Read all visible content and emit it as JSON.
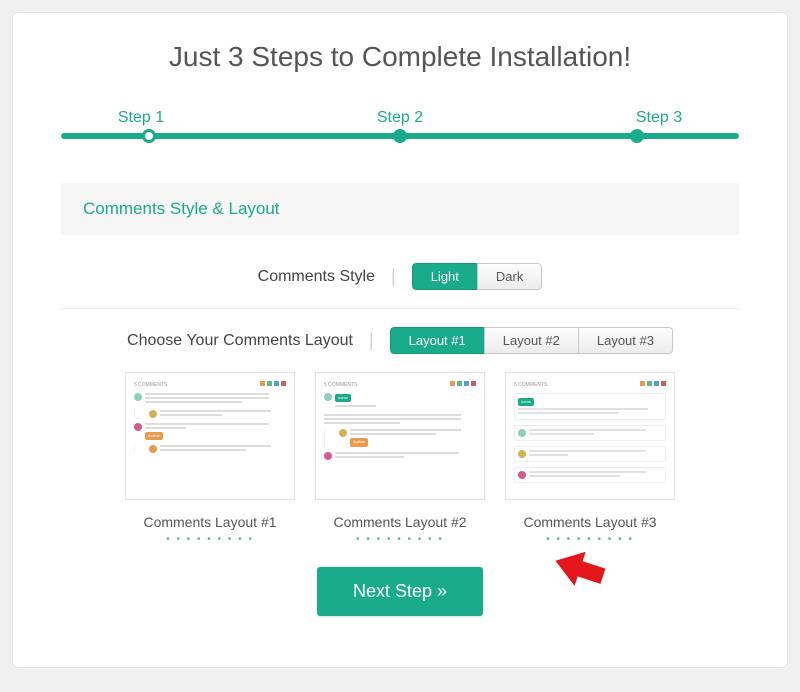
{
  "title": "Just 3 Steps to Complete Installation!",
  "stepper": {
    "steps": [
      "Step 1",
      "Step 2",
      "Step 3"
    ],
    "current": 1
  },
  "section_header": "Comments Style & Layout",
  "style_row": {
    "label": "Comments Style",
    "options": [
      "Light",
      "Dark"
    ],
    "selected": "Light"
  },
  "layout_row": {
    "label": "Choose Your Comments Layout",
    "options": [
      "Layout #1",
      "Layout #2",
      "Layout #3"
    ],
    "selected": "Layout #1"
  },
  "previews": {
    "items": [
      {
        "caption": "Comments Layout #1"
      },
      {
        "caption": "Comments Layout #2"
      },
      {
        "caption": "Comments Layout #3"
      }
    ]
  },
  "next_button": "Next Step »",
  "colors": {
    "accent": "#1aab8b",
    "text": "#555555",
    "panel": "#f6f6f6"
  }
}
